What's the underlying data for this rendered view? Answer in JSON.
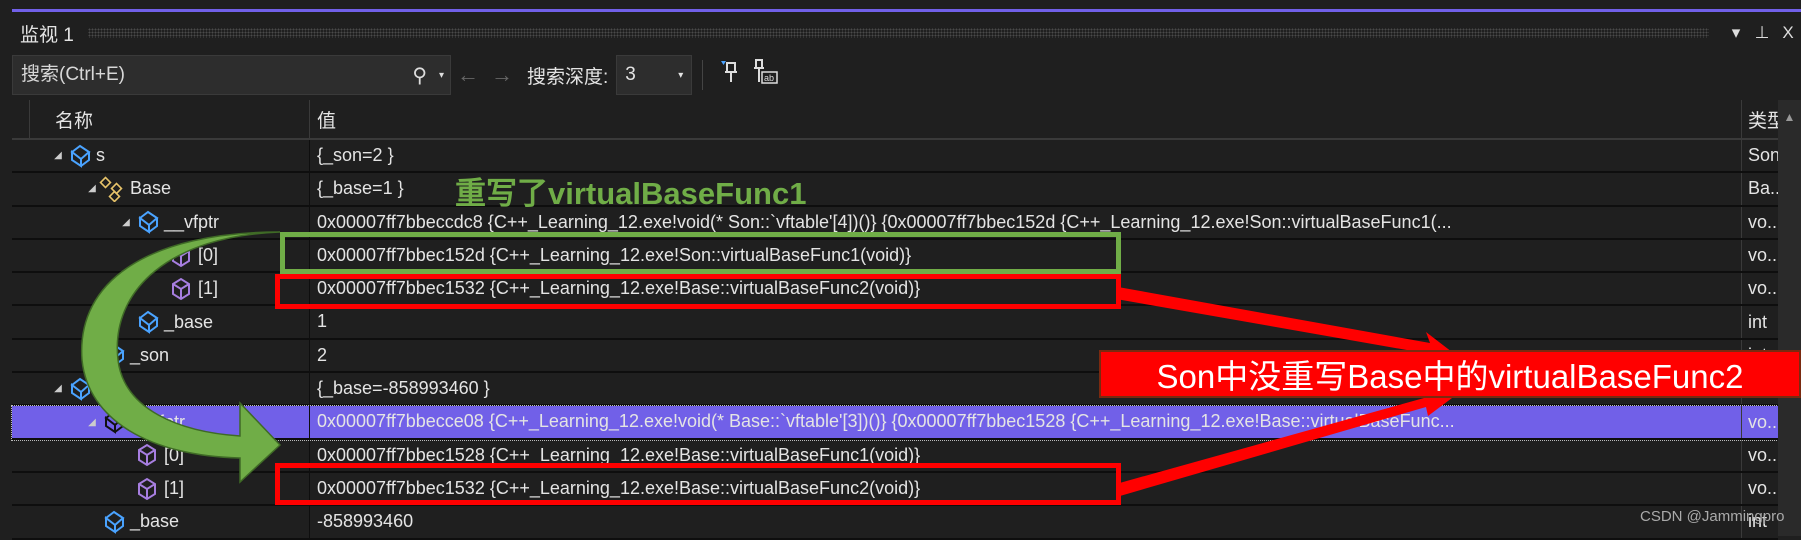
{
  "window": {
    "title": "监视 1",
    "dropdown_icon": "▾",
    "pin_icon": "⊥",
    "close_icon": "X"
  },
  "toolbar": {
    "search_placeholder": "搜索(Ctrl+E)",
    "search_icon": "⚲",
    "back_icon": "←",
    "forward_icon": "→",
    "depth_label": "搜索深度:",
    "depth_value": "3"
  },
  "columns": {
    "name": "名称",
    "value": "值",
    "type": "类型"
  },
  "rows": [
    {
      "level": 0,
      "expand": true,
      "icon": "object-blue",
      "name": "s",
      "value": "{_son=2 }",
      "type": "Son"
    },
    {
      "level": 1,
      "expand": true,
      "icon": "base-class",
      "name": "Base",
      "value": "{_base=1 }",
      "type": "Ba..."
    },
    {
      "level": 2,
      "expand": true,
      "icon": "object-blue",
      "name": "__vfptr",
      "value": "0x00007ff7bbeccdc8 {C++_Learning_12.exe!void(* Son::`vftable'[4])()} {0x00007ff7bbec152d {C++_Learning_12.exe!Son::virtualBaseFunc1(...",
      "type": "vo..."
    },
    {
      "level": 3,
      "expand": false,
      "icon": "object-purple",
      "name": "[0]",
      "value": "0x00007ff7bbec152d {C++_Learning_12.exe!Son::virtualBaseFunc1(void)}",
      "type": "vo..."
    },
    {
      "level": 3,
      "expand": false,
      "icon": "object-purple",
      "name": "[1]",
      "value": "0x00007ff7bbec1532 {C++_Learning_12.exe!Base::virtualBaseFunc2(void)}",
      "type": "vo..."
    },
    {
      "level": 2,
      "expand": false,
      "icon": "object-blue",
      "name": "_base",
      "value": "1",
      "type": "int"
    },
    {
      "level": 1,
      "expand": false,
      "icon": "object-blue",
      "name": "_son",
      "value": "2",
      "type": "int"
    },
    {
      "level": 0,
      "expand": true,
      "icon": "object-blue",
      "name": "b",
      "value": "{_base=-858993460 }",
      "type": "Base"
    },
    {
      "level": 1,
      "expand": true,
      "icon": "object-dark",
      "name": "__vfptr",
      "value": "0x00007ff7bbecce08 {C++_Learning_12.exe!void(* Base::`vftable'[3])()} {0x00007ff7bbec1528 {C++_Learning_12.exe!Base::virtualBaseFunc...",
      "type": "vo...",
      "selected": true
    },
    {
      "level": 2,
      "expand": false,
      "icon": "object-purple",
      "name": "[0]",
      "value": "0x00007ff7bbec1528 {C++_Learning_12.exe!Base::virtualBaseFunc1(void)}",
      "type": "vo..."
    },
    {
      "level": 2,
      "expand": false,
      "icon": "object-purple",
      "name": "[1]",
      "value": "0x00007ff7bbec1532 {C++_Learning_12.exe!Base::virtualBaseFunc2(void)}",
      "type": "vo..."
    },
    {
      "level": 1,
      "expand": false,
      "icon": "object-blue",
      "name": "_base",
      "value": "-858993460",
      "type": "int"
    }
  ],
  "annotations": {
    "green_text": "重写了virtualBaseFunc1",
    "red_text": "Son中没重写Base中的virtualBaseFunc2",
    "green": "#70ad47",
    "red": "#ff0000"
  },
  "watermark": "CSDN @Jammingpro",
  "colors": {
    "accent": "#7160e8",
    "background": "#1f1f1f"
  }
}
